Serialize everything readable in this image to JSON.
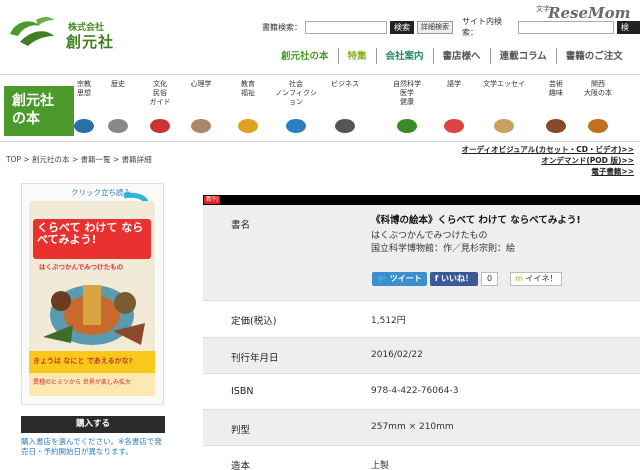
{
  "header": {
    "company_small": "株式会社",
    "company_big": "創元社",
    "book_search_label": "書籍検索：",
    "book_search_button": "検索",
    "detail_search_button": "詳細検索",
    "site_search_label": "サイト内検索：",
    "site_search_button": "検索",
    "top_right_link": "文字",
    "watermark_main": "ReseMom",
    "watermark_accent": "e"
  },
  "gnav": [
    {
      "label": "創元社の本",
      "color": "#4a9a2c"
    },
    {
      "label": "特集",
      "color": "#8db11c"
    },
    {
      "label": "会社案内",
      "color": "#1c8a5a"
    },
    {
      "label": "書店様へ",
      "color": "#555555"
    },
    {
      "label": "連載コラム",
      "color": "#555555"
    },
    {
      "label": "書籍のご注文",
      "color": "#555555"
    }
  ],
  "band_title_1": "創元社",
  "band_title_2": "の本",
  "categories": [
    {
      "line1": "宗教",
      "line2": "思想",
      "line3": "",
      "icon": "book-icon"
    },
    {
      "line1": "歴史",
      "line2": "",
      "line3": "",
      "icon": "knight-icon"
    },
    {
      "line1": "文化",
      "line2": "民俗",
      "line3": "ガイド",
      "icon": "flag-icon"
    },
    {
      "line1": "心理学",
      "line2": "",
      "line3": "",
      "icon": "people-icon"
    },
    {
      "line1": "教育",
      "line2": "福祉",
      "line3": "",
      "icon": "pencils-icon"
    },
    {
      "line1": "社会",
      "line2": "ノンフィクション",
      "line3": "",
      "icon": "globe-icon"
    },
    {
      "line1": "ビジネス",
      "line2": "",
      "line3": "",
      "icon": "laptop-icon"
    },
    {
      "line1": "自然科学",
      "line2": "医学",
      "line3": "健康",
      "icon": "sprout-icon"
    },
    {
      "line1": "語学",
      "line2": "",
      "line3": "",
      "icon": "blocks-icon"
    },
    {
      "line1": "文学エッセイ",
      "line2": "",
      "line3": "",
      "icon": "open-book-icon"
    },
    {
      "line1": "芸術",
      "line2": "趣味",
      "line3": "",
      "icon": "painter-icon"
    },
    {
      "line1": "関西",
      "line2": "大阪の本",
      "line3": "",
      "icon": "bread-icon"
    }
  ],
  "breadcrumb": "TOP > 創元社の本 > 書籍一覧 > 書籍詳細",
  "side_links": [
    "オーディオビジュアル(カセット・CD・ビデオ)>>",
    "オンデマンド(POD 版)>>",
    "電子書籍>>"
  ],
  "cover": {
    "click_label": "クリック立ち読み",
    "title": "くらべて わけて ならべてみよう!",
    "subtitle": "はくぶつかんでみつけたもの",
    "bottom": "きょうは なにと であえるかな?",
    "foot": "異種のヒミツから 世界が楽しみ拡大"
  },
  "buy": {
    "button": "購入する",
    "note": "購入書店を選んでください。※各書店で発売日・予約開始日が異なります。"
  },
  "detail": {
    "tag": "新刊",
    "title_label": "書名",
    "title_value": "《科博の絵本》くらべて わけて ならべてみよう!",
    "author1": "はくぶつかんでみつけたもの",
    "author2": "国立科学博物館：作／見杉宗則：絵",
    "tweet": "ツイート",
    "like": "いいね！",
    "like_count": "0",
    "mixi": "イイネ！",
    "rows": [
      {
        "label": "定価(税込)",
        "value": "1,512円"
      },
      {
        "label": "刊行年月日",
        "value": "2016/02/22"
      },
      {
        "label": "ISBN",
        "value": "978-4-422-76064-3"
      },
      {
        "label": "判型",
        "value": "257mm × 210mm"
      },
      {
        "label": "造本",
        "value": "上製"
      }
    ]
  }
}
